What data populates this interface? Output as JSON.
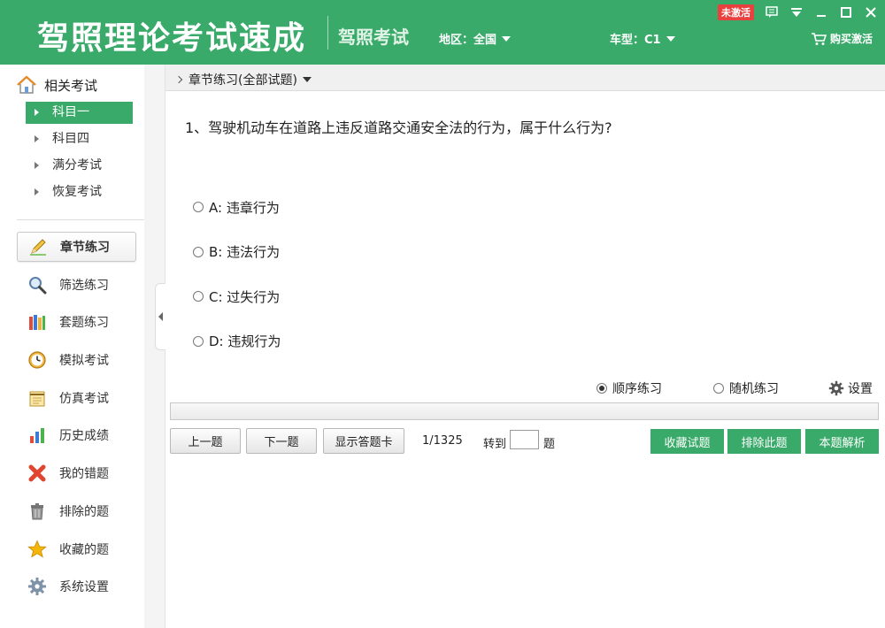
{
  "header": {
    "title": "驾照理论考试速成",
    "subtitle": "驾照考试",
    "region_label": "地区：全国",
    "cartype_label": "车型：C1",
    "badge": "未激活",
    "buy_label": "购买激活"
  },
  "sidebar": {
    "exam_heading": "相关考试",
    "exams": [
      "科目一",
      "科目四",
      "满分考试",
      "恢复考试"
    ],
    "nav": [
      {
        "label": "章节练习",
        "icon": "pencil-icon"
      },
      {
        "label": "筛选练习",
        "icon": "magnifier-icon"
      },
      {
        "label": "套题练习",
        "icon": "books-icon"
      },
      {
        "label": "模拟考试",
        "icon": "clock-icon"
      },
      {
        "label": "仿真考试",
        "icon": "notepad-icon"
      },
      {
        "label": "历史成绩",
        "icon": "bar-chart-icon"
      },
      {
        "label": "我的错题",
        "icon": "red-x-icon"
      },
      {
        "label": "排除的题",
        "icon": "trash-icon"
      },
      {
        "label": "收藏的题",
        "icon": "star-icon"
      },
      {
        "label": "系统设置",
        "icon": "gear-icon"
      }
    ]
  },
  "main": {
    "breadcrumb": "章节练习(全部试题)",
    "question": "1、驾驶机动车在道路上违反道路交通安全法的行为，属于什么行为?",
    "options": [
      "A: 违章行为",
      "B: 违法行为",
      "C: 过失行为",
      "D: 违规行为"
    ],
    "mode_sequential": "顺序练习",
    "mode_random": "随机练习",
    "settings_label": "设置",
    "progress_fraction": 0.0,
    "prev_label": "上一题",
    "next_label": "下一题",
    "card_label": "显示答题卡",
    "counter": "1/1325",
    "goto_label": "转到",
    "goto_suffix": "题",
    "goto_value": "",
    "fav_label": "收藏试题",
    "exclude_label": "排除此题",
    "analysis_label": "本题解析"
  },
  "colors": {
    "accent": "#3aaa6a",
    "badge": "#e8413e"
  }
}
